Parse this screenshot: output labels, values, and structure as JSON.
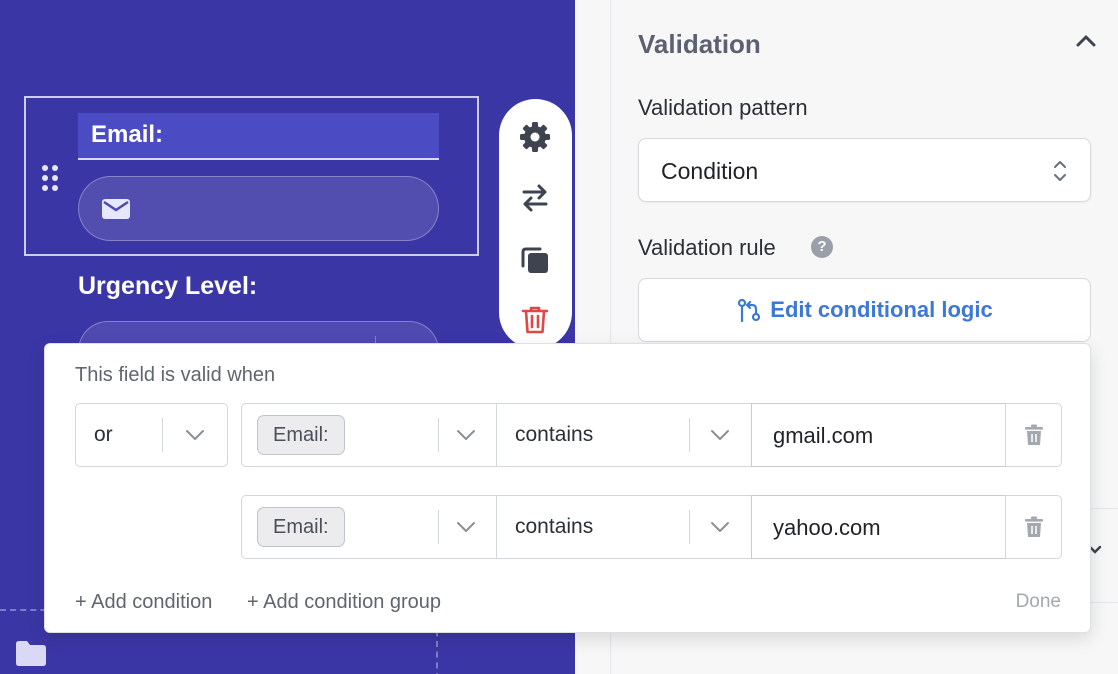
{
  "canvas": {
    "email_label": "Email:",
    "urgency_label": "Urgency Level:",
    "toolbar": [
      "gear-icon",
      "swap-icon",
      "copy-icon",
      "trash-icon"
    ]
  },
  "panel": {
    "section_title": "Validation",
    "pattern_label": "Validation pattern",
    "pattern_value": "Condition",
    "rule_label": "Validation rule",
    "help": "?",
    "edit_logic_label": "Edit conditional logic",
    "accent_color": "#3b78d8"
  },
  "popover": {
    "title": "This field is valid when",
    "operator": "or",
    "conditions": [
      {
        "field": "Email:",
        "comparator": "contains",
        "value": "gmail.com"
      },
      {
        "field": "Email:",
        "comparator": "contains",
        "value": "yahoo.com"
      }
    ],
    "add_condition": "+ Add condition",
    "add_group": "+ Add condition group",
    "done": "Done"
  },
  "colors": {
    "canvas_bg": "#3b36a6",
    "delete_red": "#e04848"
  }
}
